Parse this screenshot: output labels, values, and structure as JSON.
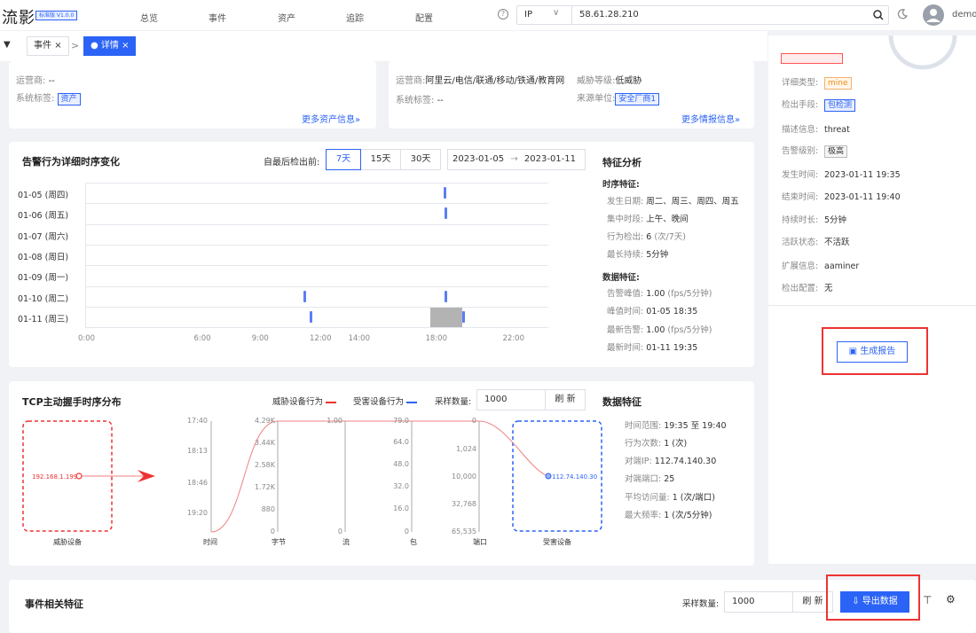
{
  "app": {
    "logo": "流影",
    "version": "标准版 V1.0.0",
    "user": "demo"
  },
  "nav": [
    "总览",
    "事件",
    "资产",
    "追踪",
    "配置"
  ],
  "search": {
    "type": "IP",
    "value": "58.61.28.210"
  },
  "tabs": [
    {
      "label": "事件",
      "close": "×",
      "active": false
    },
    {
      "label": "● 详情",
      "close": "×",
      "active": true
    }
  ],
  "asset_card": {
    "operator_label": "运营商:",
    "operator_value": "--",
    "tags_label": "系统标签:",
    "tag": "资产",
    "more": "更多资产信息»"
  },
  "intel_card": {
    "operator_label": "运营商:",
    "operator_value": "阿里云/电信/联通/移动/铁通/教育网",
    "system_label": "系统标签:",
    "system_value": "--",
    "threat_label": "威胁等级:",
    "threat_value": "低威胁",
    "source_label": "来源单位:",
    "source_value": "安全厂商1",
    "more": "更多情报信息»"
  },
  "timeline": {
    "title": "告警行为详细时序变化",
    "detect_label": "自最后检出前:",
    "ranges": [
      "7天",
      "15天",
      "30天"
    ],
    "active_range": "7天",
    "date_from": "2023-01-05",
    "date_arrow": "→",
    "date_to": "2023-01-11"
  },
  "chart_data": {
    "type": "scatter",
    "categories": [
      "01-05 (周四)",
      "01-06 (周五)",
      "01-07 (周六)",
      "01-08 (周日)",
      "01-09 (周一)",
      "01-10 (周二)",
      "01-11 (周三)"
    ],
    "x_ticks": [
      {
        "label": "0:00",
        "hour": 0
      },
      {
        "label": "6:00",
        "hour": 6
      },
      {
        "label": "9:00",
        "hour": 9
      },
      {
        "label": "12:00",
        "hour": 12
      },
      {
        "label": "14:00",
        "hour": 14
      },
      {
        "label": "18:00",
        "hour": 18
      },
      {
        "label": "22:00",
        "hour": 22
      }
    ],
    "events": [
      {
        "day": 0,
        "hour": 18.6
      },
      {
        "day": 1,
        "hour": 18.65
      },
      {
        "day": 5,
        "hour": 11.35
      },
      {
        "day": 5,
        "hour": 18.65
      },
      {
        "day": 6,
        "hour": 11.7
      },
      {
        "day": 6,
        "hour": 19.6
      }
    ],
    "highlight": {
      "day": 6,
      "from_hour": 17.9,
      "to_hour": 19.55
    },
    "event_color": "#5b7ef2"
  },
  "feature_analysis": {
    "title": "特征分析",
    "timing_title": "时序特征:",
    "timing": [
      {
        "label": "发生日期:",
        "value": "周二、周三、周四、周五"
      },
      {
        "label": "集中时段:",
        "value": "上午、晚间"
      },
      {
        "label": "行为检出:",
        "value": "6",
        "unit": "(次/7天)"
      },
      {
        "label": "最长持续:",
        "value": "5分钟"
      }
    ],
    "data_title": "数据特征:",
    "data": [
      {
        "label": "告警峰值:",
        "value": "1.00",
        "unit": "(fps/5分钟)"
      },
      {
        "label": "峰值时间:",
        "value": "01-05 18:35"
      },
      {
        "label": "最新告警:",
        "value": "1.00",
        "unit": "(fps/5分钟)"
      },
      {
        "label": "最新时间:",
        "value": "01-11 19:35"
      }
    ]
  },
  "tcp": {
    "title": "TCP主动握手时序分布",
    "legend_threat": "威胁设备行为",
    "legend_victim": "受害设备行为",
    "sample_label": "采样数量:",
    "sample_value": "1000",
    "refresh": "刷 新",
    "threat_ip": "192.168.1.199",
    "victim_ip": "112.74.140.30",
    "threat_device": "威胁设备",
    "victim_device": "受害设备",
    "axes": [
      {
        "name": "时间",
        "ticks": [
          "17:40",
          "18:13",
          "18:46",
          "19:20"
        ]
      },
      {
        "name": "字节",
        "ticks": [
          "4.29K",
          "3.44K",
          "2.58K",
          "1.72K",
          "880",
          "0"
        ]
      },
      {
        "name": "流",
        "ticks": [
          "1.00",
          "0"
        ]
      },
      {
        "name": "包",
        "ticks": [
          "79.0",
          "64.0",
          "48.0",
          "32.0",
          "16.0",
          "0"
        ]
      },
      {
        "name": "端口",
        "ticks": [
          "0",
          "1,024",
          "10,000",
          "32,768",
          "65,535"
        ]
      }
    ],
    "features_title": "数据特征",
    "features": [
      {
        "label": "时间范围:",
        "value": "19:35 至 19:40"
      },
      {
        "label": "行为次数:",
        "value": "1 (次)"
      },
      {
        "label": "对端IP:",
        "value": "112.74.140.30"
      },
      {
        "label": "对端端口:",
        "value": "25"
      },
      {
        "label": "平均访问量:",
        "value": "1 (次/端口)"
      },
      {
        "label": "最大频率:",
        "value": "1 (次/5分钟)"
      }
    ]
  },
  "right_panel": {
    "rows": [
      {
        "label": "详细类型:",
        "value": "mine",
        "tag": "orange"
      },
      {
        "label": "检出手段:",
        "value": "包检测",
        "tag": "blue"
      },
      {
        "label": "描述信息:",
        "value": "threat"
      },
      {
        "label": "告警级别:",
        "value": "极高",
        "tag": "gray"
      },
      {
        "label": "发生时间:",
        "value": "2023-01-11 19:35"
      },
      {
        "label": "结束时间:",
        "value": "2023-01-11 19:40"
      },
      {
        "label": "持续时长:",
        "value": "5分钟"
      },
      {
        "label": "活跃状态:",
        "value": "不活跃"
      },
      {
        "label": "扩展信息:",
        "value": "aaminer"
      },
      {
        "label": "检出配置:",
        "value": "无"
      }
    ],
    "report_button": "生成报告"
  },
  "bottom": {
    "title": "事件相关特征",
    "sample_label": "采样数量:",
    "sample_value": "1000",
    "refresh": "刷 新",
    "export": "导出数据"
  }
}
